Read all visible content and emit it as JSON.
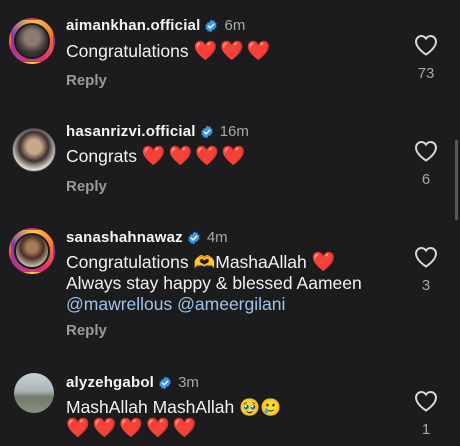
{
  "comments": [
    {
      "username": "aimankhan.official",
      "time": "6m",
      "text_prefix": "Congratulations",
      "hearts": "❤️❤️❤️",
      "reply_label": "Reply",
      "likes": "73"
    },
    {
      "username": "hasanrizvi.official",
      "time": "16m",
      "text_prefix": "Congrats",
      "hearts": "❤️❤️❤️❤️",
      "reply_label": "Reply",
      "likes": "6"
    },
    {
      "username": "sanashahnawaz",
      "time": "4m",
      "line1_a": "Congratulations",
      "line1_emoji": "🫶",
      "line1_b": "MashaAllah",
      "line1_heart": "❤️",
      "line2": "Always stay happy & blessed Aameen",
      "mention1": "@mawrellous",
      "mention2": "@ameergilani",
      "reply_label": "Reply",
      "likes": "3"
    },
    {
      "username": "alyzehgabol",
      "time": "3m",
      "line1_text": "MashAllah MashAllah",
      "line1_emojis": "🥹🥲",
      "line2_hearts": "❤️❤️❤️❤️❤️",
      "likes": "1"
    }
  ],
  "icons": {
    "verified": "verified-badge-icon",
    "like": "heart-outline-icon"
  },
  "colors": {
    "background": "#1c1c1e",
    "verified": "#3897f0",
    "mention": "#9fc3ec",
    "secondary_text": "#a8a8a8"
  }
}
